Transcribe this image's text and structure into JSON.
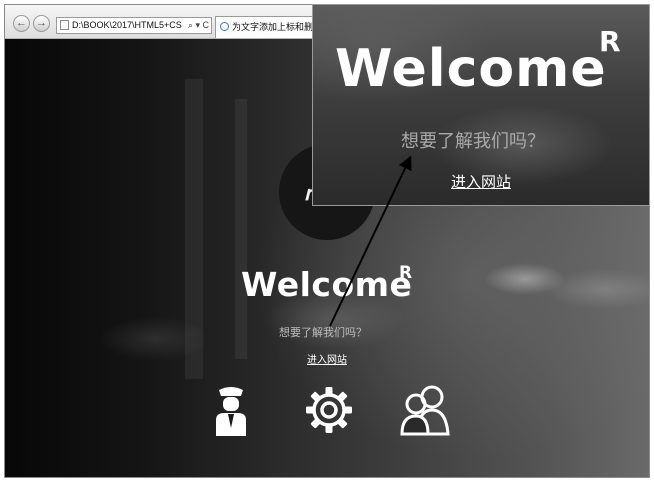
{
  "browser": {
    "address": "D:\\BOOK\\2017\\HTML5+CS",
    "address_controls": "⌕ ▾ C",
    "tab_title": "为文字添加上标和删除线",
    "back_glyph": "←",
    "forward_glyph": "→"
  },
  "page": {
    "logo_glyph": "㎡",
    "welcome": "Welcome",
    "welcome_superscript": "R",
    "question": "想要了解我们吗？",
    "enter_link": "进入网站",
    "icons": [
      "driver-icon",
      "gear-icon",
      "users-icon"
    ]
  },
  "callout": {
    "welcome": "Welcome",
    "welcome_superscript": "R",
    "question": "想要了解我们吗？",
    "enter_link": "进入网站"
  },
  "colors": {
    "text_main": "#ffffff",
    "text_muted": "#bdbdbd",
    "arrow": "#000000"
  }
}
